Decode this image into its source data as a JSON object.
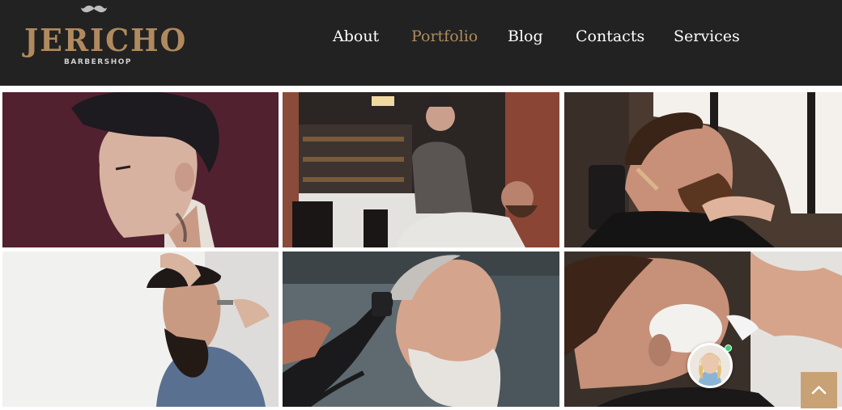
{
  "brand": {
    "name": "JERICHO",
    "tagline": "BARBERSHOP",
    "logo_icon": "mustache-icon",
    "accent_color": "#b08a5e"
  },
  "nav": {
    "items": [
      {
        "label": "About",
        "active": false
      },
      {
        "label": "Portfolio",
        "active": true
      },
      {
        "label": "Blog",
        "active": false
      },
      {
        "label": "Contacts",
        "active": false
      },
      {
        "label": "Services",
        "active": false
      }
    ]
  },
  "portfolio": {
    "images": [
      {
        "subject": "man-side-profile-pompadour"
      },
      {
        "subject": "barber-shaving-client-in-shop"
      },
      {
        "subject": "barber-trimming-beard-with-razor"
      },
      {
        "subject": "bearded-man-haircut"
      },
      {
        "subject": "grey-bearded-man-clipper-cut"
      },
      {
        "subject": "beard-shave-with-foam"
      }
    ]
  },
  "widgets": {
    "chat_avatar_icon": "support-avatar-icon",
    "chat_status": "online",
    "status_color": "#3fd07a",
    "scroll_top_icon": "chevron-up-icon",
    "scroll_top_color": "#c8a275"
  }
}
